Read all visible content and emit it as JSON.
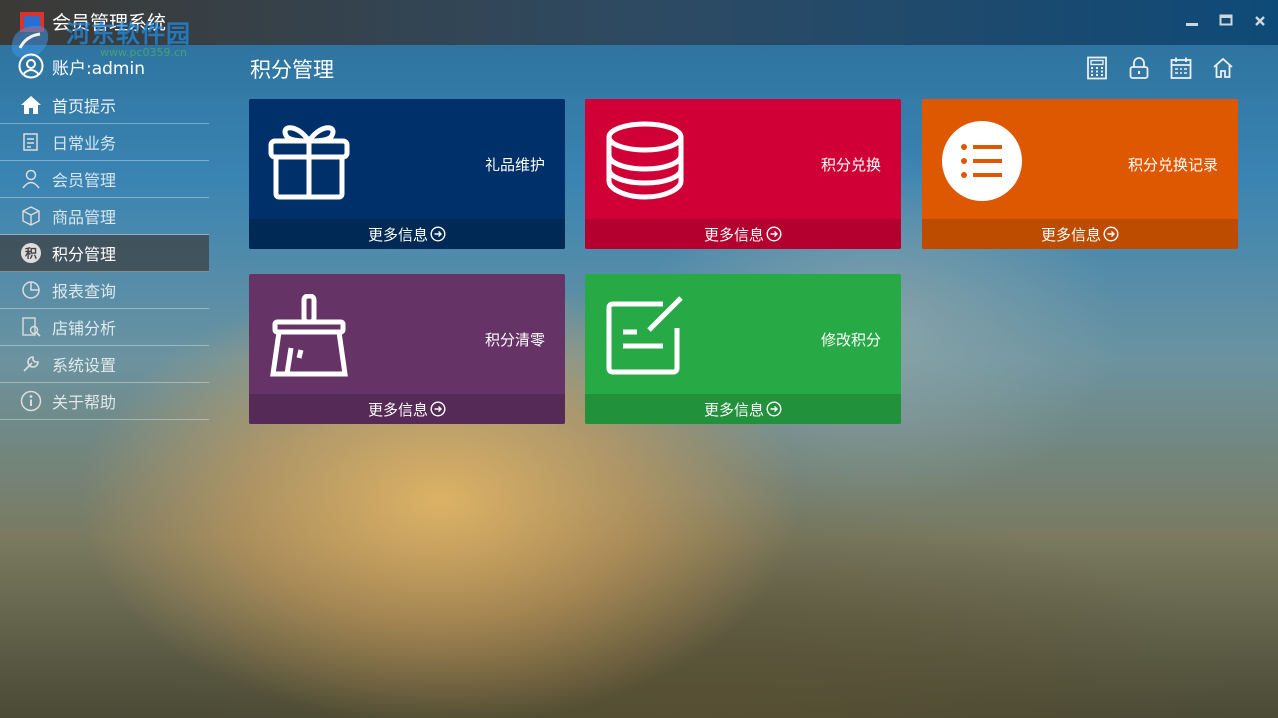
{
  "window": {
    "title": "会员管理系统",
    "watermark": "河东软件园",
    "watermark_url": "www.pc0359.cn",
    "controls": [
      "minimize-icon",
      "maximize-icon",
      "close-icon"
    ]
  },
  "sidebar": {
    "account_label": "账户:admin",
    "items": [
      {
        "label": "首页提示",
        "icon": "home-icon",
        "active": false
      },
      {
        "label": "日常业务",
        "icon": "notepad-icon",
        "active": false
      },
      {
        "label": "会员管理",
        "icon": "user-icon",
        "active": false
      },
      {
        "label": "商品管理",
        "icon": "box-icon",
        "active": false
      },
      {
        "label": "积分管理",
        "icon": "points-icon",
        "badge": "积",
        "active": true
      },
      {
        "label": "报表查询",
        "icon": "pie-chart-icon",
        "active": false
      },
      {
        "label": "店铺分析",
        "icon": "document-search-icon",
        "active": false
      },
      {
        "label": "系统设置",
        "icon": "wrench-icon",
        "active": false
      },
      {
        "label": "关于帮助",
        "icon": "info-icon",
        "active": false
      }
    ]
  },
  "main": {
    "title": "积分管理",
    "toolbar_icons": [
      "calculator-icon",
      "lock-icon",
      "calendar-icon",
      "home-icon"
    ],
    "tiles": [
      {
        "label": "礼品维护",
        "more": "更多信息",
        "color": "#00306a",
        "footer_color": "#002955",
        "icon": "gift-icon"
      },
      {
        "label": "积分兑换",
        "more": "更多信息",
        "color": "#d00037",
        "footer_color": "#b3002f",
        "icon": "database-icon"
      },
      {
        "label": "积分兑换记录",
        "more": "更多信息",
        "color": "#dd5800",
        "footer_color": "#bd4b00",
        "icon": "list-icon"
      },
      {
        "label": "积分清零",
        "more": "更多信息",
        "color": "#663366",
        "footer_color": "#562a56",
        "icon": "broom-icon"
      },
      {
        "label": "修改积分",
        "more": "更多信息",
        "color": "#27aa46",
        "footer_color": "#22913c",
        "icon": "edit-icon"
      }
    ]
  }
}
